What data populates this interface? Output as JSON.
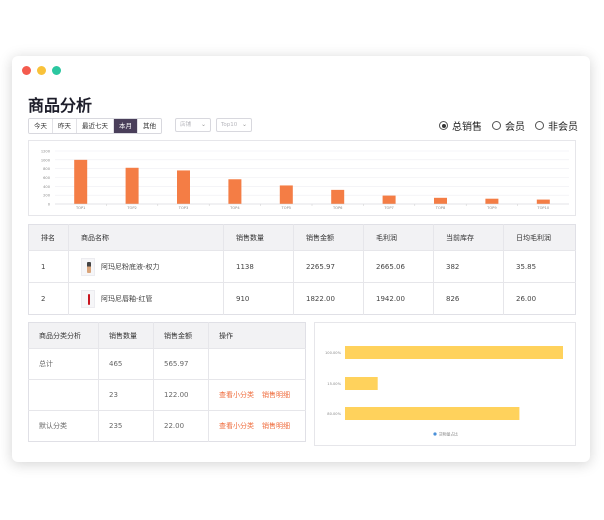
{
  "window": {
    "title": "商品分析"
  },
  "filters": {
    "periods": [
      "今天",
      "昨天",
      "最近七天",
      "本月",
      "其他"
    ],
    "active_period": "本月",
    "select1_placeholder": "店铺",
    "select2_placeholder": "Top10"
  },
  "radios": {
    "options": [
      "总销售",
      "会员",
      "非会员"
    ],
    "checked": "总销售"
  },
  "chart_data": [
    {
      "type": "bar",
      "categories": [
        "TOP1",
        "TOP2",
        "TOP3",
        "TOP4",
        "TOP5",
        "TOP6",
        "TOP7",
        "TOP8",
        "TOP9",
        "TOP10"
      ],
      "values": [
        1000,
        820,
        760,
        560,
        420,
        320,
        190,
        140,
        120,
        100
      ],
      "yticks": [
        "0",
        "200",
        "400",
        "600",
        "800",
        "1000",
        "1200"
      ],
      "ylim": [
        0,
        1200
      ],
      "color": "#f47d45"
    },
    {
      "type": "bar",
      "orientation": "horizontal",
      "categories": [
        "100.00%",
        "15.00%",
        "80.00%"
      ],
      "values": [
        100,
        15,
        80
      ],
      "legend": "货物量占比",
      "color": "#ffd25c"
    }
  ],
  "table1": {
    "headers": [
      "排名",
      "商品名称",
      "销售数量",
      "销售金额",
      "毛利润",
      "当前库存",
      "日均毛利润"
    ],
    "rows": [
      {
        "rank": "1",
        "name": "阿玛尼粉底液-权力",
        "qty": "1138",
        "amount": "2265.97",
        "profit": "2665.06",
        "stock": "382",
        "daily": "35.85"
      },
      {
        "rank": "2",
        "name": "阿玛尼唇釉-红管",
        "qty": "910",
        "amount": "1822.00",
        "profit": "1942.00",
        "stock": "826",
        "daily": "26.00"
      }
    ]
  },
  "table2": {
    "headers": [
      "商品分类分析",
      "销售数量",
      "销售金额",
      "操作"
    ],
    "rows": [
      {
        "cat": "总计",
        "qty": "465",
        "amount": "565.97",
        "action1": "",
        "action2": ""
      },
      {
        "cat": "",
        "qty": "23",
        "amount": "122.00",
        "action1": "查看小分类",
        "action2": "销售明细"
      },
      {
        "cat": "默认分类",
        "qty": "235",
        "amount": "22.00",
        "action1": "查看小分类",
        "action2": "销售明细"
      }
    ]
  }
}
